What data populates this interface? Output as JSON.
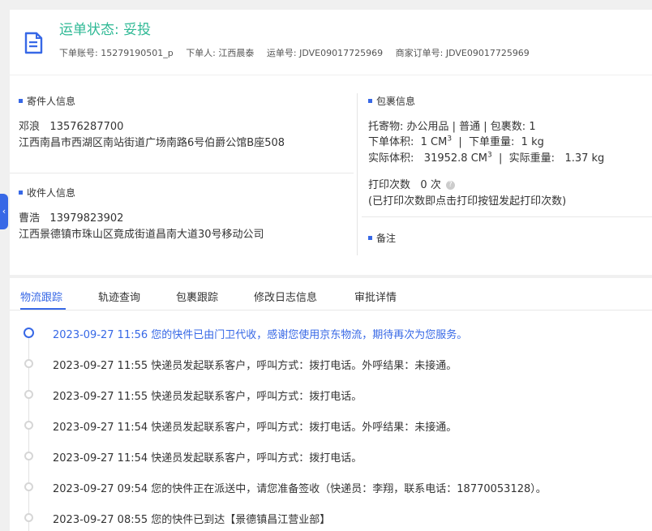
{
  "header": {
    "status_label": "运单状态:",
    "status_value": "妥投",
    "meta": [
      {
        "label": "下单账号:",
        "value": "15279190501_p"
      },
      {
        "label": "下单人:",
        "value": "江西晨泰"
      },
      {
        "label": "运单号:",
        "value": "JDVE09017725969"
      },
      {
        "label": "商家订单号:",
        "value": "JDVE09017725969"
      }
    ]
  },
  "sender": {
    "title": "寄件人信息",
    "name": "邓浪",
    "phone": "13576287700",
    "address": "江西南昌市西湖区南站街道广场南路6号伯爵公馆B座508"
  },
  "receiver": {
    "title": "收件人信息",
    "name": "曹浩",
    "phone": "13979823902",
    "address": "江西景德镇市珠山区竟成街道昌南大道30号移动公司"
  },
  "package": {
    "title": "包裹信息",
    "line1": "托寄物:  办公用品 | 普通 | 包裹数:  1",
    "vol_label": "下单体积:",
    "vol_value": "1 CM",
    "vol_unit_sup": "3",
    "weight_label": "下单重量:",
    "weight_value": "1 kg",
    "real_vol_label": "实际体积:",
    "real_vol_value": "31952.8 CM",
    "real_vol_unit_sup": "3",
    "real_weight_label": "实际重量:",
    "real_weight_value": "1.37 kg",
    "print_label": "打印次数",
    "print_value": "0 次",
    "print_note": "(已打印次数即点击打印按钮发起打印次数)"
  },
  "remark": {
    "title": "备注"
  },
  "tabs": [
    "物流跟踪",
    "轨迹查询",
    "包裹跟踪",
    "修改日志信息",
    "审批详情"
  ],
  "active_tab": 0,
  "timeline": [
    {
      "text": "2023-09-27 11:56 您的快件已由门卫代收，感谢您使用京东物流，期待再次为您服务。",
      "current": true
    },
    {
      "text": "2023-09-27 11:55 快递员发起联系客户，呼叫方式：拨打电话。外呼结果：未接通。",
      "current": false
    },
    {
      "text": "2023-09-27 11:55 快递员发起联系客户，呼叫方式：拨打电话。",
      "current": false
    },
    {
      "text": "2023-09-27 11:54 快递员发起联系客户，呼叫方式：拨打电话。外呼结果：未接通。",
      "current": false
    },
    {
      "text": "2023-09-27 11:54 快递员发起联系客户，呼叫方式：拨打电话。",
      "current": false
    },
    {
      "text": "2023-09-27 09:54 您的快件正在派送中，请您准备签收（快递员：李翔，联系电话：18770053128）。",
      "current": false
    },
    {
      "text": "2023-09-27 08:55 您的快件已到达【景德镇昌江营业部】",
      "current": false
    }
  ],
  "colors": {
    "accent": "#3768e6",
    "status_green": "#2fb995"
  },
  "icons": {
    "header": "document-icon",
    "side_tab": "chevron-left-icon",
    "help": "question-circle-icon"
  }
}
